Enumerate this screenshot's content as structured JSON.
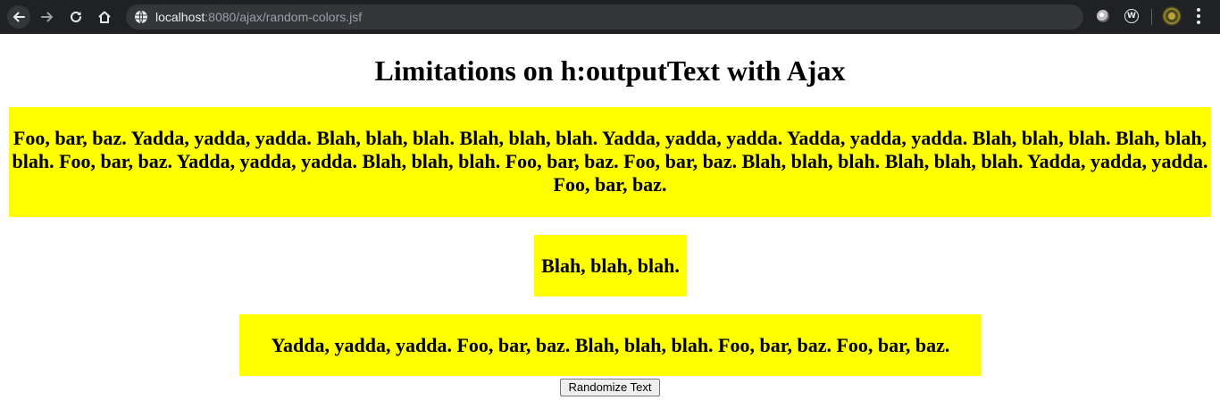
{
  "browser": {
    "url_host": "localhost",
    "url_rest": ":8080/ajax/random-colors.jsf",
    "icons": {
      "back": "arrow-left-icon",
      "forward": "arrow-right-icon",
      "reload": "reload-icon",
      "home": "home-icon",
      "site_info": "globe-icon",
      "extension1": "circle-extension-icon",
      "extension2": "w-extension-icon",
      "profile": "avatar",
      "menu": "kebab-menu-icon"
    }
  },
  "page": {
    "title": "Limitations on h:outputText with Ajax",
    "highlight_color": "#ffff00",
    "text1": "Foo, bar, baz. Yadda, yadda, yadda. Blah, blah, blah. Blah, blah, blah. Yadda, yadda, yadda. Yadda, yadda, yadda. Blah, blah, blah. Blah, blah, blah. Foo, bar, baz. Yadda, yadda, yadda. Blah, blah, blah. Foo, bar, baz. Foo, bar, baz. Blah, blah, blah. Blah, blah, blah. Yadda, yadda, yadda. Foo, bar, baz.",
    "text2": "Blah, blah, blah.",
    "text3": "Yadda, yadda, yadda. Foo, bar, baz. Blah, blah, blah. Foo, bar, baz. Foo, bar, baz.",
    "button_label": "Randomize Text"
  }
}
